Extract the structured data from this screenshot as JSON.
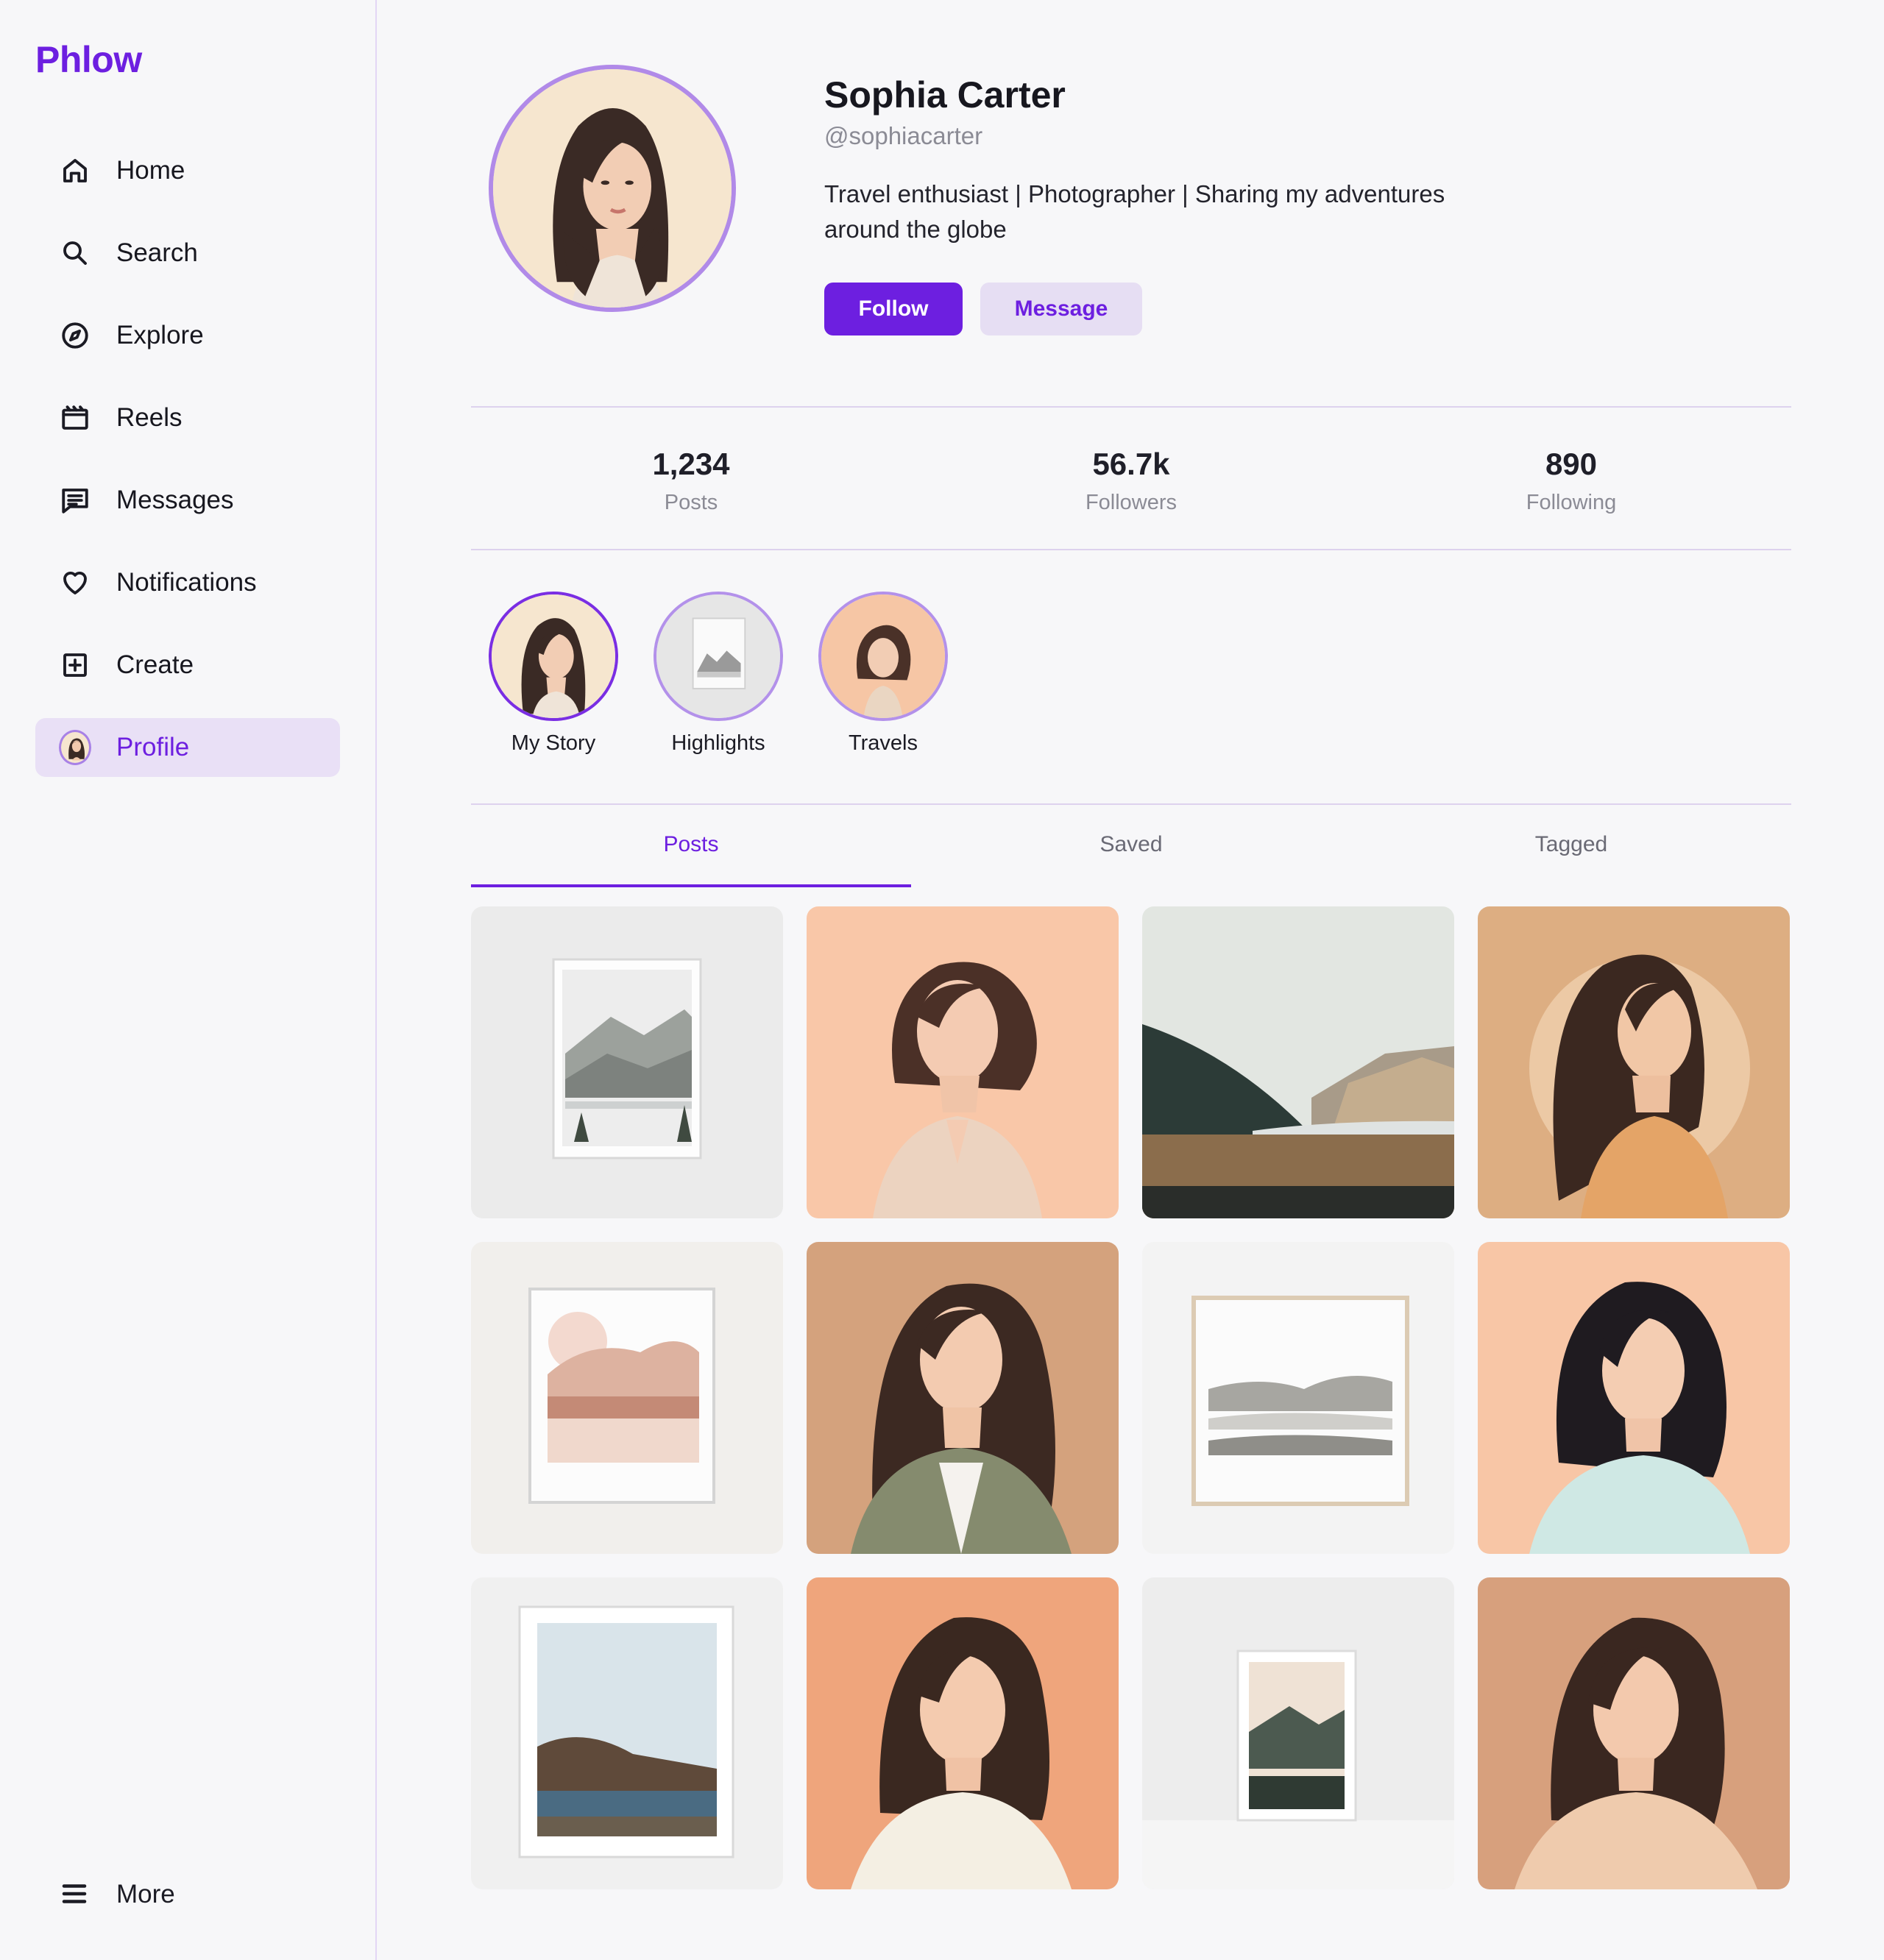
{
  "app": {
    "name": "Phlow"
  },
  "nav": {
    "items": [
      {
        "label": "Home",
        "icon": "home-icon"
      },
      {
        "label": "Search",
        "icon": "search-icon"
      },
      {
        "label": "Explore",
        "icon": "compass-icon"
      },
      {
        "label": "Reels",
        "icon": "clapperboard-icon"
      },
      {
        "label": "Messages",
        "icon": "message-icon"
      },
      {
        "label": "Notifications",
        "icon": "heart-icon"
      },
      {
        "label": "Create",
        "icon": "plus-square-icon"
      },
      {
        "label": "Profile",
        "icon": "avatar",
        "active": true
      }
    ],
    "more": {
      "label": "More",
      "icon": "menu-icon"
    }
  },
  "profile": {
    "name": "Sophia Carter",
    "handle": "@sophiacarter",
    "bio": "Travel enthusiast | Photographer | Sharing my adventures around the globe",
    "follow_label": "Follow",
    "message_label": "Message"
  },
  "stats": [
    {
      "value": "1,234",
      "label": "Posts"
    },
    {
      "value": "56.7k",
      "label": "Followers"
    },
    {
      "value": "890",
      "label": "Following"
    }
  ],
  "stories": [
    {
      "label": "My Story"
    },
    {
      "label": "Highlights"
    },
    {
      "label": "Travels"
    }
  ],
  "tabs": [
    {
      "label": "Posts",
      "active": true
    },
    {
      "label": "Saved"
    },
    {
      "label": "Tagged"
    }
  ],
  "colors": {
    "accent": "#6d1fe0",
    "accent_light": "#e9e0f6",
    "background": "#f7f7f9",
    "muted_text": "#8b8b95"
  }
}
